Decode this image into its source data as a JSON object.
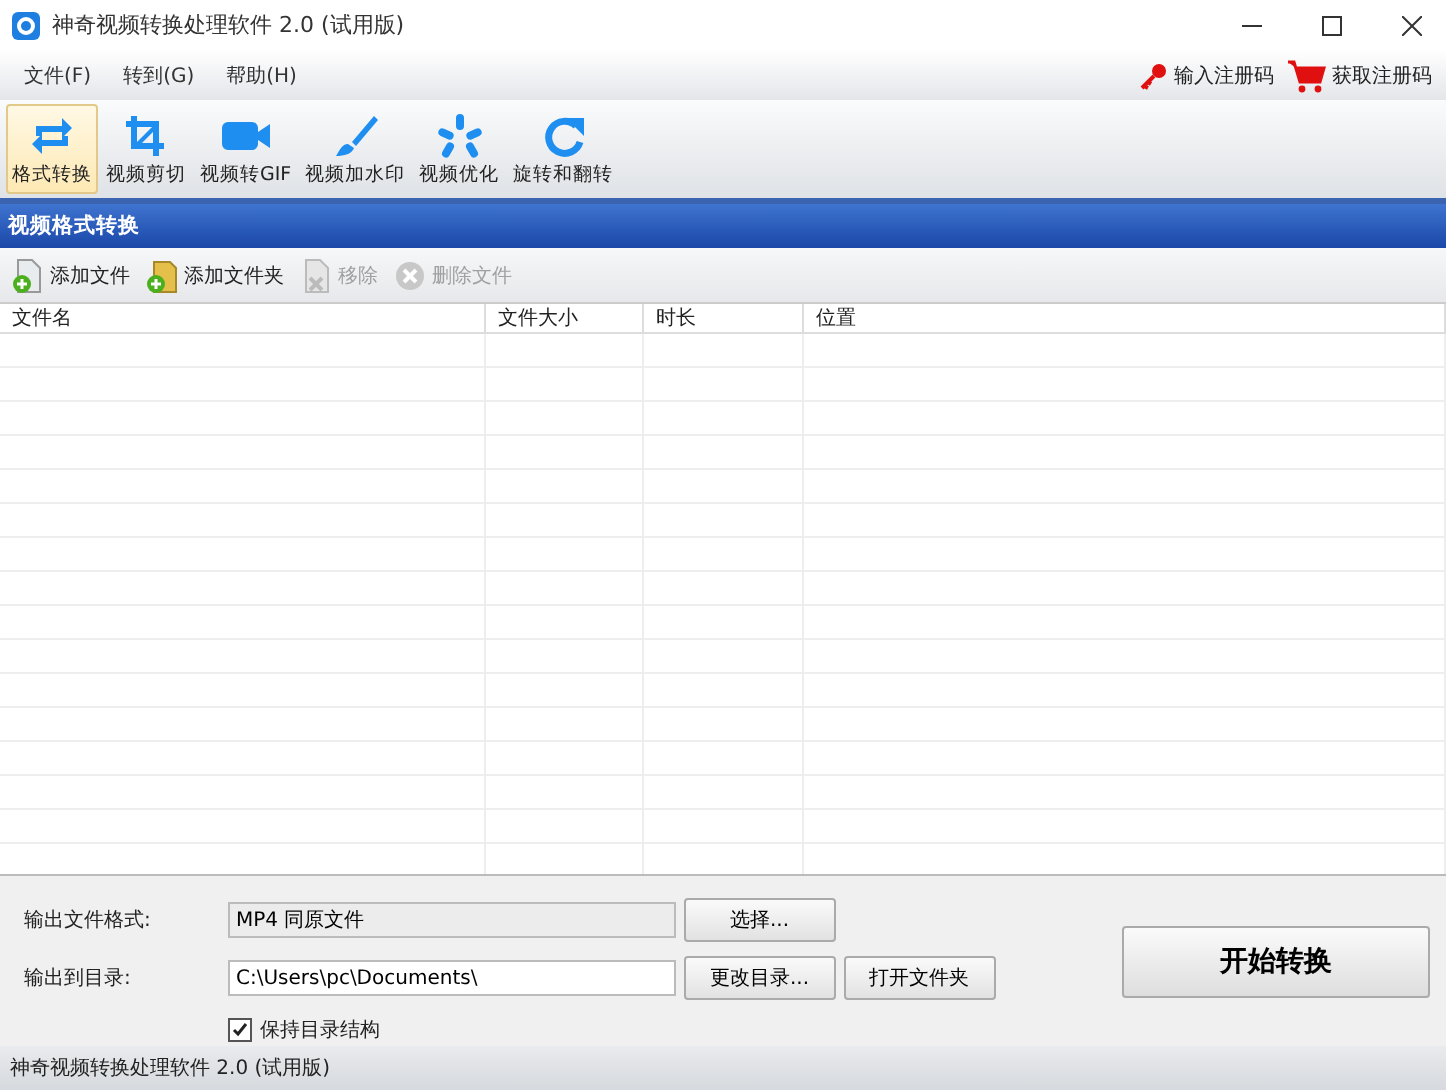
{
  "window": {
    "title": "神奇视频转换处理软件 2.0 (试用版)"
  },
  "menu": [
    "文件(F)",
    "转到(G)",
    "帮助(H)"
  ],
  "register_links": [
    {
      "kind": "key",
      "label": "输入注册码"
    },
    {
      "kind": "cart",
      "label": "获取注册码"
    }
  ],
  "toolbar": [
    {
      "kind": "convert",
      "label": "格式转换",
      "selected": true
    },
    {
      "kind": "crop",
      "label": "视频剪切",
      "selected": false
    },
    {
      "kind": "gif",
      "label": "视频转GIF",
      "selected": false
    },
    {
      "kind": "brush",
      "label": "视频加水印",
      "selected": false
    },
    {
      "kind": "optimize",
      "label": "视频优化",
      "selected": false
    },
    {
      "kind": "rotate",
      "label": "旋转和翻转",
      "selected": false
    }
  ],
  "panel_title": "视频格式转换",
  "file_actions": [
    {
      "kind": "add_file",
      "label": "添加文件",
      "disabled": false
    },
    {
      "kind": "add_folder",
      "label": "添加文件夹",
      "disabled": false
    },
    {
      "kind": "remove",
      "label": "移除",
      "disabled": true
    },
    {
      "kind": "delete",
      "label": "删除文件",
      "disabled": true
    }
  ],
  "table": {
    "columns": [
      "文件名",
      "文件大小",
      "时长",
      "位置"
    ]
  },
  "output": {
    "format_label": "输出文件格式:",
    "format_value": "MP4 同原文件",
    "choose_button": "选择...",
    "dir_label": "输出到目录:",
    "dir_value": "C:\\Users\\pc\\Documents\\",
    "change_dir_button": "更改目录...",
    "open_folder_button": "打开文件夹",
    "keep_structure": {
      "label": "保持目录结构",
      "checked": true
    },
    "start_button": "开始转换"
  },
  "status_bar": "神奇视频转换处理软件 2.0 (试用版)"
}
